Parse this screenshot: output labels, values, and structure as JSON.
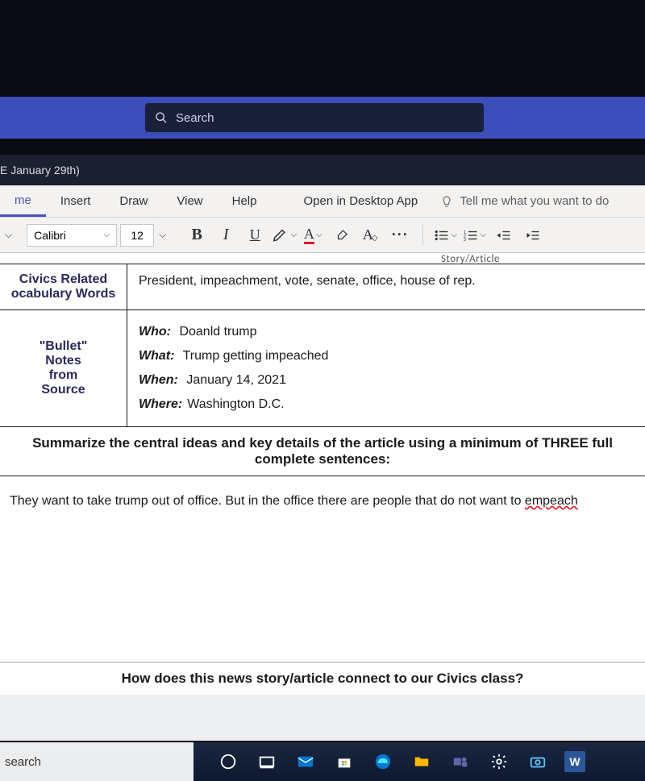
{
  "titlebar": {
    "search_placeholder": "Search"
  },
  "doctab": {
    "title": "E January 29th)"
  },
  "ribbon": {
    "tabs": {
      "home": "me",
      "insert": "Insert",
      "draw": "Draw",
      "view": "View",
      "help": "Help"
    },
    "open_desktop": "Open in Desktop App",
    "tell_me": "Tell me what you want to do"
  },
  "toolbar": {
    "font": "Calibri",
    "size": "12",
    "bold": "B",
    "italic": "I",
    "underline": "U",
    "font_color": "A",
    "clear_fmt": "A",
    "more": "···"
  },
  "doc": {
    "cutoff": "Story/Article",
    "vocab_label_l1": "Civics Related",
    "vocab_label_l2": "ocabulary Words",
    "vocab_text": "President, impeachment, vote, senate, office, house of rep.",
    "notes_label_l1": "\"Bullet\"",
    "notes_label_l2": "Notes",
    "notes_label_l3": "from",
    "notes_label_l4": "Source",
    "who_k": "Who:",
    "who_v": "Doanld trump",
    "what_k": "What:",
    "what_v": "Trump getting impeached",
    "when_k": "When:",
    "when_v": "January 14, 2021",
    "where_k": "Where:",
    "where_v": "Washington D.C.",
    "summary_head": "Summarize the central ideas and key details of the article using a minimum of THREE full complete sentences:",
    "summary_body_pre": "They want to take trump out of office. But in the office there are people that do not want to ",
    "summary_body_err": "empeach",
    "connect_head": "How does this news story/article connect to our Civics class?"
  },
  "taskbar": {
    "search": " search"
  }
}
